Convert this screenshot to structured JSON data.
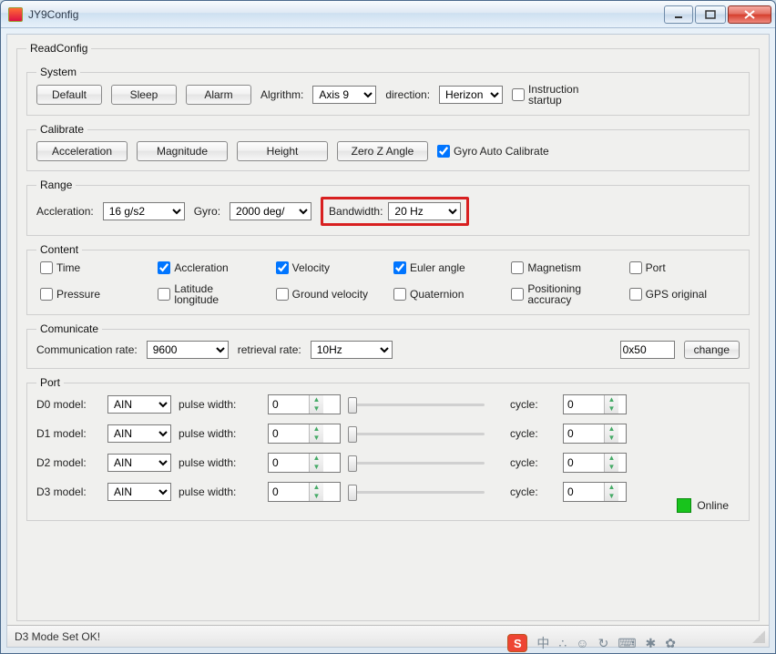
{
  "window": {
    "title": "JY9Config"
  },
  "panel": {
    "title": "ReadConfig"
  },
  "system": {
    "legend": "System",
    "default_btn": "Default",
    "sleep_btn": "Sleep",
    "alarm_btn": "Alarm",
    "algorithm_label": "Algrithm:",
    "algorithm_value": "Axis 9",
    "direction_label": "direction:",
    "direction_value": "Herizon",
    "instruction_startup_label": "Instruction startup",
    "instruction_startup_checked": false
  },
  "calibrate": {
    "legend": "Calibrate",
    "accel_btn": "Acceleration",
    "mag_btn": "Magnitude",
    "height_btn": "Height",
    "zeroz_btn": "Zero Z Angle",
    "gyro_auto_label": "Gyro Auto Calibrate",
    "gyro_auto_checked": true
  },
  "range": {
    "legend": "Range",
    "accel_label": "Accleration:",
    "accel_value": "16 g/s2",
    "gyro_label": "Gyro:",
    "gyro_value": "2000 deg/",
    "bandwidth_label": "Bandwidth:",
    "bandwidth_value": "20",
    "bandwidth_unit": "Hz"
  },
  "content": {
    "legend": "Content",
    "items": [
      {
        "label": "Time",
        "checked": false
      },
      {
        "label": "Accleration",
        "checked": true
      },
      {
        "label": "Velocity",
        "checked": true
      },
      {
        "label": "Euler angle",
        "checked": true
      },
      {
        "label": "Magnetism",
        "checked": false
      },
      {
        "label": "Port",
        "checked": false
      },
      {
        "label": "Pressure",
        "checked": false
      },
      {
        "label": "Latitude longitude",
        "checked": false
      },
      {
        "label": "Ground velocity",
        "checked": false
      },
      {
        "label": "Quaternion",
        "checked": false
      },
      {
        "label": "Positioning accuracy",
        "checked": false
      },
      {
        "label": "GPS original",
        "checked": false
      }
    ]
  },
  "communicate": {
    "legend": "Comunicate",
    "rate_label": "Communication rate:",
    "rate_value": "9600",
    "retrieval_label": "retrieval rate:",
    "retrieval_value": "10Hz",
    "addr_value": "0x50",
    "change_btn": "change"
  },
  "port": {
    "legend": "Port",
    "pulse_width_label": "pulse width:",
    "cycle_label": "cycle:",
    "rows": [
      {
        "label": "D0 model:",
        "model": "AIN",
        "pulse": "0",
        "cycle": "0"
      },
      {
        "label": "D1 model:",
        "model": "AIN",
        "pulse": "0",
        "cycle": "0"
      },
      {
        "label": "D2 model:",
        "model": "AIN",
        "pulse": "0",
        "cycle": "0"
      },
      {
        "label": "D3 model:",
        "model": "AIN",
        "pulse": "0",
        "cycle": "0"
      }
    ]
  },
  "online_label": "Online",
  "statusbar": {
    "text": "D3 Mode Set OK!"
  },
  "tray_glyphs": [
    "中",
    "∴",
    "☺",
    "↻",
    "⌨",
    "✱",
    "✿"
  ]
}
